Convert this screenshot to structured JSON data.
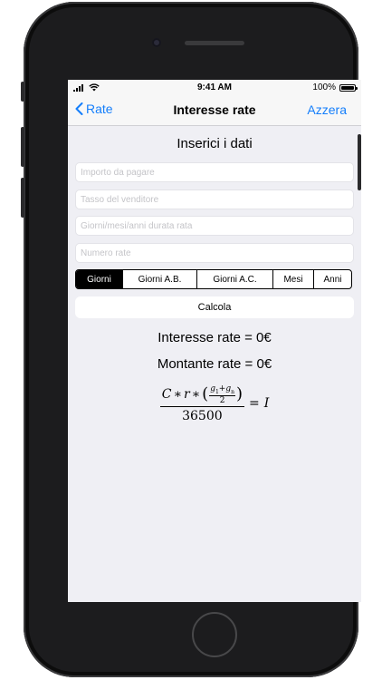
{
  "status_bar": {
    "time": "9:41 AM",
    "battery": "100%"
  },
  "nav": {
    "back_label": "Rate",
    "title": "Interesse rate",
    "action_label": "Azzera"
  },
  "form": {
    "title": "Inserici i dati",
    "fields": [
      {
        "placeholder": "Importo da pagare",
        "value": ""
      },
      {
        "placeholder": "Tasso del venditore",
        "value": ""
      },
      {
        "placeholder": "Giorni/mesi/anni durata rata",
        "value": ""
      },
      {
        "placeholder": "Numero rate",
        "value": ""
      }
    ],
    "segments": [
      "Giorni",
      "Giorni A.B.",
      "Giorni A.C.",
      "Mesi",
      "Anni"
    ],
    "selected_segment": "Giorni",
    "calc_button": "Calcola"
  },
  "results": {
    "interesse": "Interesse rate = 0€",
    "montante": "Montante rate = 0€"
  },
  "formula": {
    "C": "C",
    "mult": "∗",
    "r": "r",
    "g1": "g",
    "g1_sub": "1",
    "plus": "+",
    "gn": "g",
    "gn_sub": "n",
    "half_den": "2",
    "den": "36500",
    "eq": "=",
    "rhs": "I"
  },
  "icons": {
    "back": "chevron-left-icon",
    "signal": "cellular-signal-icon",
    "wifi": "wifi-icon",
    "battery": "battery-icon"
  },
  "colors": {
    "accent": "#147efb",
    "background": "#efeff4",
    "selected_segment": "#000000"
  }
}
